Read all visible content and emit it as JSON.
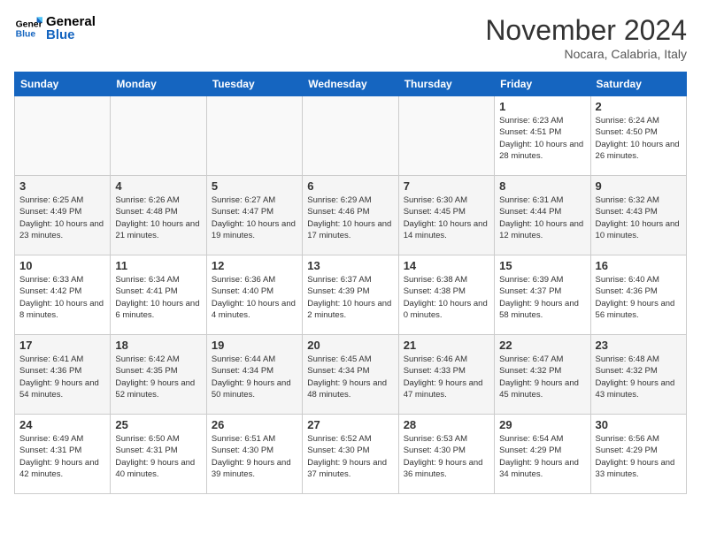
{
  "header": {
    "logo_general": "General",
    "logo_blue": "Blue",
    "month": "November 2024",
    "location": "Nocara, Calabria, Italy"
  },
  "weekdays": [
    "Sunday",
    "Monday",
    "Tuesday",
    "Wednesday",
    "Thursday",
    "Friday",
    "Saturday"
  ],
  "weeks": [
    [
      {
        "day": "",
        "info": ""
      },
      {
        "day": "",
        "info": ""
      },
      {
        "day": "",
        "info": ""
      },
      {
        "day": "",
        "info": ""
      },
      {
        "day": "",
        "info": ""
      },
      {
        "day": "1",
        "info": "Sunrise: 6:23 AM\nSunset: 4:51 PM\nDaylight: 10 hours and 28 minutes."
      },
      {
        "day": "2",
        "info": "Sunrise: 6:24 AM\nSunset: 4:50 PM\nDaylight: 10 hours and 26 minutes."
      }
    ],
    [
      {
        "day": "3",
        "info": "Sunrise: 6:25 AM\nSunset: 4:49 PM\nDaylight: 10 hours and 23 minutes."
      },
      {
        "day": "4",
        "info": "Sunrise: 6:26 AM\nSunset: 4:48 PM\nDaylight: 10 hours and 21 minutes."
      },
      {
        "day": "5",
        "info": "Sunrise: 6:27 AM\nSunset: 4:47 PM\nDaylight: 10 hours and 19 minutes."
      },
      {
        "day": "6",
        "info": "Sunrise: 6:29 AM\nSunset: 4:46 PM\nDaylight: 10 hours and 17 minutes."
      },
      {
        "day": "7",
        "info": "Sunrise: 6:30 AM\nSunset: 4:45 PM\nDaylight: 10 hours and 14 minutes."
      },
      {
        "day": "8",
        "info": "Sunrise: 6:31 AM\nSunset: 4:44 PM\nDaylight: 10 hours and 12 minutes."
      },
      {
        "day": "9",
        "info": "Sunrise: 6:32 AM\nSunset: 4:43 PM\nDaylight: 10 hours and 10 minutes."
      }
    ],
    [
      {
        "day": "10",
        "info": "Sunrise: 6:33 AM\nSunset: 4:42 PM\nDaylight: 10 hours and 8 minutes."
      },
      {
        "day": "11",
        "info": "Sunrise: 6:34 AM\nSunset: 4:41 PM\nDaylight: 10 hours and 6 minutes."
      },
      {
        "day": "12",
        "info": "Sunrise: 6:36 AM\nSunset: 4:40 PM\nDaylight: 10 hours and 4 minutes."
      },
      {
        "day": "13",
        "info": "Sunrise: 6:37 AM\nSunset: 4:39 PM\nDaylight: 10 hours and 2 minutes."
      },
      {
        "day": "14",
        "info": "Sunrise: 6:38 AM\nSunset: 4:38 PM\nDaylight: 10 hours and 0 minutes."
      },
      {
        "day": "15",
        "info": "Sunrise: 6:39 AM\nSunset: 4:37 PM\nDaylight: 9 hours and 58 minutes."
      },
      {
        "day": "16",
        "info": "Sunrise: 6:40 AM\nSunset: 4:36 PM\nDaylight: 9 hours and 56 minutes."
      }
    ],
    [
      {
        "day": "17",
        "info": "Sunrise: 6:41 AM\nSunset: 4:36 PM\nDaylight: 9 hours and 54 minutes."
      },
      {
        "day": "18",
        "info": "Sunrise: 6:42 AM\nSunset: 4:35 PM\nDaylight: 9 hours and 52 minutes."
      },
      {
        "day": "19",
        "info": "Sunrise: 6:44 AM\nSunset: 4:34 PM\nDaylight: 9 hours and 50 minutes."
      },
      {
        "day": "20",
        "info": "Sunrise: 6:45 AM\nSunset: 4:34 PM\nDaylight: 9 hours and 48 minutes."
      },
      {
        "day": "21",
        "info": "Sunrise: 6:46 AM\nSunset: 4:33 PM\nDaylight: 9 hours and 47 minutes."
      },
      {
        "day": "22",
        "info": "Sunrise: 6:47 AM\nSunset: 4:32 PM\nDaylight: 9 hours and 45 minutes."
      },
      {
        "day": "23",
        "info": "Sunrise: 6:48 AM\nSunset: 4:32 PM\nDaylight: 9 hours and 43 minutes."
      }
    ],
    [
      {
        "day": "24",
        "info": "Sunrise: 6:49 AM\nSunset: 4:31 PM\nDaylight: 9 hours and 42 minutes."
      },
      {
        "day": "25",
        "info": "Sunrise: 6:50 AM\nSunset: 4:31 PM\nDaylight: 9 hours and 40 minutes."
      },
      {
        "day": "26",
        "info": "Sunrise: 6:51 AM\nSunset: 4:30 PM\nDaylight: 9 hours and 39 minutes."
      },
      {
        "day": "27",
        "info": "Sunrise: 6:52 AM\nSunset: 4:30 PM\nDaylight: 9 hours and 37 minutes."
      },
      {
        "day": "28",
        "info": "Sunrise: 6:53 AM\nSunset: 4:30 PM\nDaylight: 9 hours and 36 minutes."
      },
      {
        "day": "29",
        "info": "Sunrise: 6:54 AM\nSunset: 4:29 PM\nDaylight: 9 hours and 34 minutes."
      },
      {
        "day": "30",
        "info": "Sunrise: 6:56 AM\nSunset: 4:29 PM\nDaylight: 9 hours and 33 minutes."
      }
    ]
  ]
}
